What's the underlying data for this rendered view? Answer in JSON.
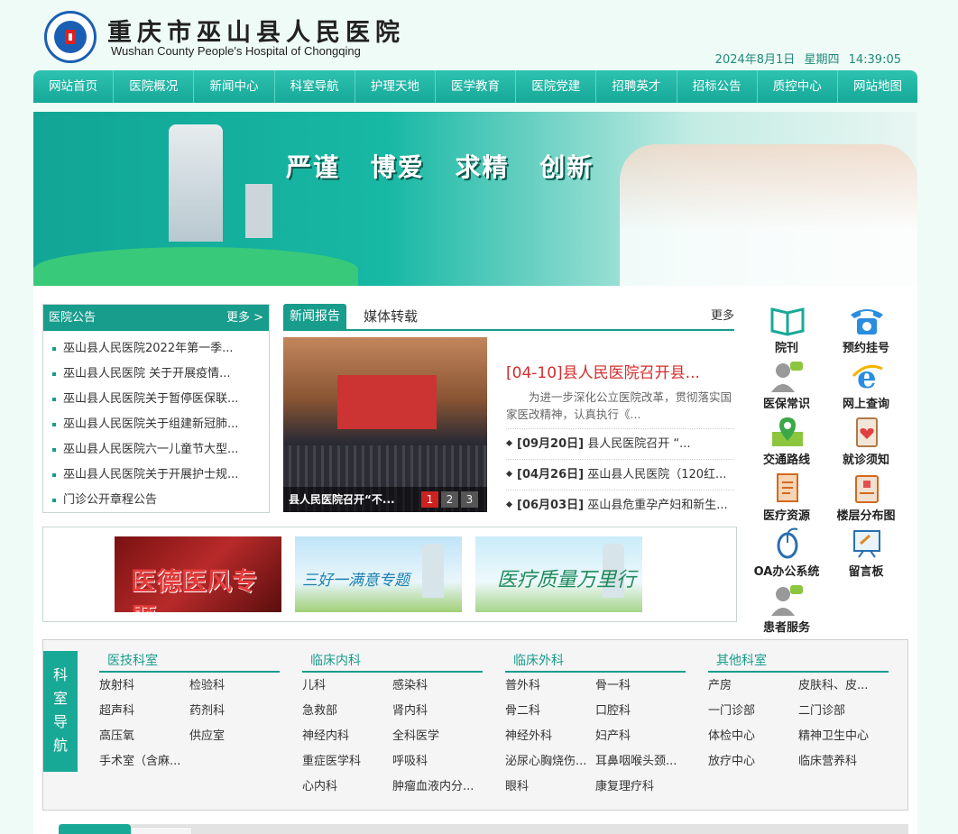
{
  "header": {
    "name_cn": "重庆市巫山县人民医院",
    "name_en": "Wushan County People's Hospital of Chongqing",
    "date": "2024年8月1日",
    "weekday": "星期四",
    "time": "14:39:05"
  },
  "nav": [
    "网站首页",
    "医院概况",
    "新闻中心",
    "科室导航",
    "护理天地",
    "医学教育",
    "医院党建",
    "招聘英才",
    "招标公告",
    "质控中心",
    "网站地图"
  ],
  "banner": {
    "slogan": "严谨 博爱 求精 创新"
  },
  "notice": {
    "title": "医院公告",
    "more": "更多 >",
    "items": [
      "巫山县人民医院2022年第一季...",
      "巫山县人民医院 关于开展疫情...",
      "巫山县人民医院关于暂停医保联...",
      "巫山县人民医院关于组建新冠肺...",
      "巫山县人民医院六一儿童节大型...",
      "巫山县人民医院关于开展护士规...",
      "门诊公开章程公告"
    ]
  },
  "news": {
    "tab_active": "新闻报告",
    "tab_other": "媒体转载",
    "more": "更多",
    "image_caption": "县人民医院召开“不...",
    "pager": [
      "1",
      "2",
      "3"
    ],
    "headline": "[04-10]县人民医院召开县...",
    "summary": "为进一步深化公立医院改革，贯彻落实国家医改精神，认真执行《...",
    "list": [
      {
        "date": "[09月20日]",
        "title": "县人民医院召开 “..."
      },
      {
        "date": "[04月26日]",
        "title": "巫山县人民医院（120红..."
      },
      {
        "date": "[06月03日]",
        "title": "巫山县危重孕产妇和新生..."
      }
    ]
  },
  "topics": [
    "医德医风专题",
    "三好一满意专题",
    "医疗质量万里行"
  ],
  "quick_links": [
    {
      "label": "院刊",
      "icon": "book-icon"
    },
    {
      "label": "预约挂号",
      "icon": "phone-icon"
    },
    {
      "label": "医保常识",
      "icon": "person-chat-icon"
    },
    {
      "label": "网上查询",
      "icon": "browser-icon"
    },
    {
      "label": "交通路线",
      "icon": "map-pin-icon"
    },
    {
      "label": "就诊须知",
      "icon": "clipboard-heart-icon"
    },
    {
      "label": "医疗资源",
      "icon": "document-icon"
    },
    {
      "label": "楼层分布图",
      "icon": "building-icon"
    },
    {
      "label": "OA办公系统",
      "icon": "mouse-icon"
    },
    {
      "label": "留言板",
      "icon": "board-icon"
    },
    {
      "label": "患者服务",
      "icon": "person-chat-icon"
    }
  ],
  "departments": {
    "side_label": [
      "科",
      "室",
      "导",
      "航"
    ],
    "columns": [
      {
        "title": "医技科室",
        "items": [
          "放射科",
          "检验科",
          "超声科",
          "药剂科",
          "高压氧",
          "供应室",
          "手术室（含麻..."
        ]
      },
      {
        "title": "临床内科",
        "items": [
          "儿科",
          "感染科",
          "急救部",
          "肾内科",
          "神经内科",
          "全科医学",
          "重症医学科",
          "呼吸科",
          "心内科",
          "肿瘤血液内分..."
        ]
      },
      {
        "title": "临床外科",
        "items": [
          "普外科",
          "骨一科",
          "骨二科",
          "口腔科",
          "神经外科",
          "妇产科",
          "泌尿心胸烧伤...",
          "耳鼻咽喉头颈...",
          "眼科",
          "康复理疗科"
        ]
      },
      {
        "title": "其他科室",
        "items": [
          "产房",
          "皮肤科、皮...",
          "一门诊部",
          "二门诊部",
          "体检中心",
          "精神卫生中心",
          "放疗中心",
          "临床营养科"
        ]
      }
    ]
  },
  "colors": {
    "primary": "#189c8c",
    "nav": "#1fb3a2",
    "headline": "#d62c2c",
    "page_bg": "#effbf6"
  }
}
